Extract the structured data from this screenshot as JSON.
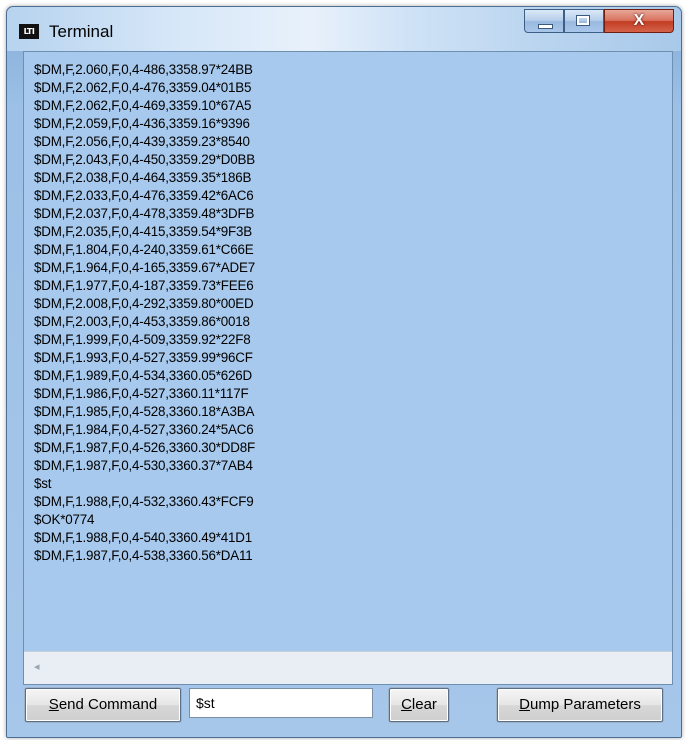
{
  "window": {
    "title": "Terminal",
    "app_icon_text": "LTI",
    "close_glyph": "X"
  },
  "output_lines": [
    "$DM,F,2.060,F,0,4-486,3358.97*24BB",
    "$DM,F,2.062,F,0,4-476,3359.04*01B5",
    "$DM,F,2.062,F,0,4-469,3359.10*67A5",
    "$DM,F,2.059,F,0,4-436,3359.16*9396",
    "$DM,F,2.056,F,0,4-439,3359.23*8540",
    "$DM,F,2.043,F,0,4-450,3359.29*D0BB",
    "$DM,F,2.038,F,0,4-464,3359.35*186B",
    "$DM,F,2.033,F,0,4-476,3359.42*6AC6",
    "$DM,F,2.037,F,0,4-478,3359.48*3DFB",
    "$DM,F,2.035,F,0,4-415,3359.54*9F3B",
    "$DM,F,1.804,F,0,4-240,3359.61*C66E",
    "$DM,F,1.964,F,0,4-165,3359.67*ADE7",
    "$DM,F,1.977,F,0,4-187,3359.73*FEE6",
    "$DM,F,2.008,F,0,4-292,3359.80*00ED",
    "$DM,F,2.003,F,0,4-453,3359.86*0018",
    "$DM,F,1.999,F,0,4-509,3359.92*22F8",
    "$DM,F,1.993,F,0,4-527,3359.99*96CF",
    "$DM,F,1.989,F,0,4-534,3360.05*626D",
    "$DM,F,1.986,F,0,4-527,3360.11*117F",
    "$DM,F,1.985,F,0,4-528,3360.18*A3BA",
    "$DM,F,1.984,F,0,4-527,3360.24*5AC6",
    "$DM,F,1.987,F,0,4-526,3360.30*DD8F",
    "$DM,F,1.987,F,0,4-530,3360.37*7AB4",
    "$st",
    "$DM,F,1.988,F,0,4-532,3360.43*FCF9",
    "$OK*0774",
    "$DM,F,1.988,F,0,4-540,3360.49*41D1",
    "$DM,F,1.987,F,0,4-538,3360.56*DA11"
  ],
  "controls": {
    "send_command": {
      "mnemonic": "S",
      "rest": "end Command"
    },
    "command_value": "$st",
    "clear": {
      "mnemonic": "C",
      "rest": "lear"
    },
    "dump_parameters": {
      "mnemonic": "D",
      "rest": "ump Parameters"
    }
  },
  "scroll_left_glyph": "◂"
}
